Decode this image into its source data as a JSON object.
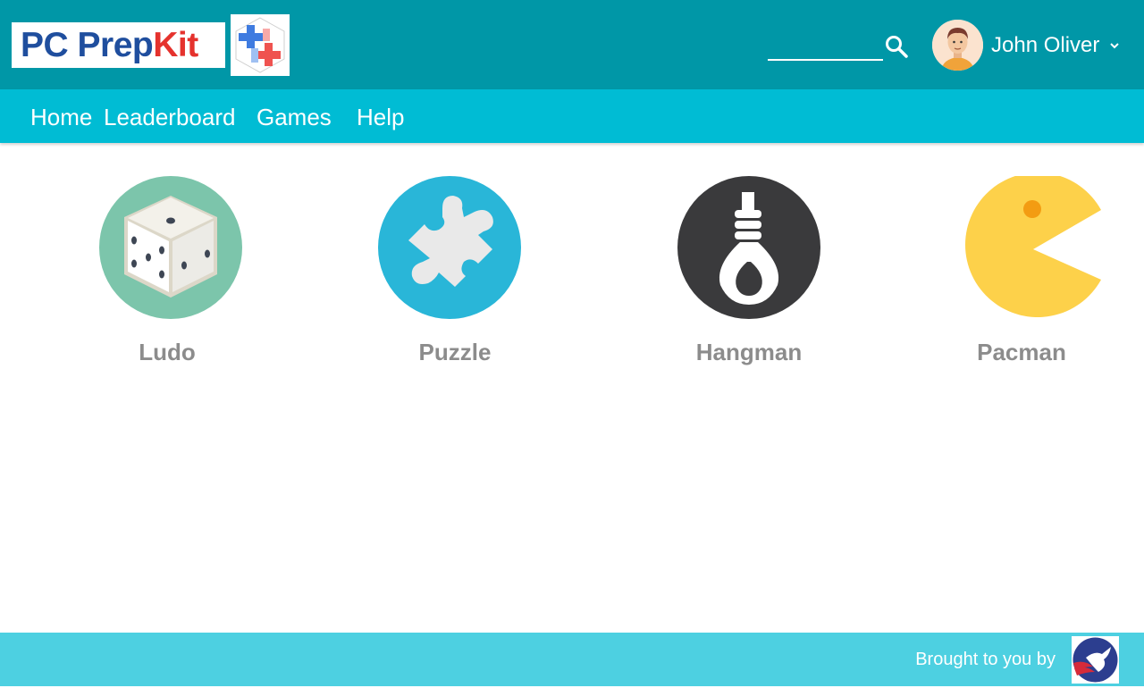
{
  "header": {
    "logo_text_main": "PC Prep",
    "logo_text_accent": "Kit",
    "search_placeholder": "",
    "user_name": "John Oliver"
  },
  "nav": {
    "items": [
      {
        "label": "Home"
      },
      {
        "label": "Leaderboard"
      },
      {
        "label": "Games"
      },
      {
        "label": "Help"
      }
    ]
  },
  "games": [
    {
      "label": "Ludo",
      "icon": "dice-icon",
      "color": "#7cc5ab"
    },
    {
      "label": "Puzzle",
      "icon": "puzzle-piece-icon",
      "color": "#29b6d8"
    },
    {
      "label": "Hangman",
      "icon": "noose-icon",
      "color": "#3a3a3c"
    },
    {
      "label": "Pacman",
      "icon": "pacman-icon",
      "color": "#fdd14a"
    }
  ],
  "footer": {
    "text": "Brought to you by",
    "logo_icon": "peace-corps-logo-icon"
  },
  "colors": {
    "header_bg": "#0097a7",
    "nav_bg": "#00bcd4",
    "footer_bg": "#4dd0e1",
    "label_gray": "#8c8c8c"
  }
}
